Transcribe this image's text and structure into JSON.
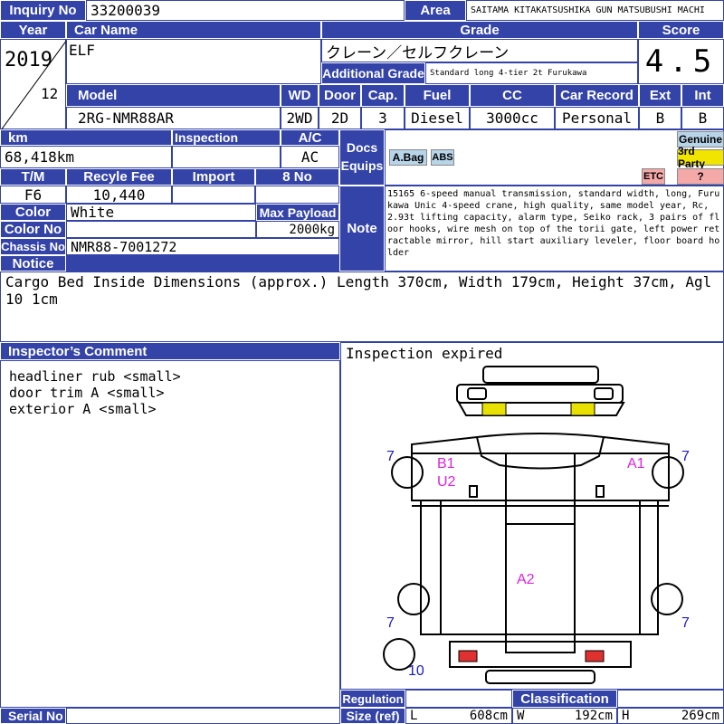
{
  "header": {
    "inquiry_label": "Inquiry No",
    "inquiry_value": "33200039",
    "area_label": "Area",
    "area_value": "SAITAMA KITAKATSUSHIKA GUN MATSUBUSHI MACHI",
    "year_label": "Year",
    "car_name_label": "Car Name",
    "grade_label": "Grade",
    "score_label": "Score",
    "year_value": "2019",
    "month_value": "12",
    "car_name_value": "ELF",
    "grade_value": "クレーン／セルフクレーン",
    "additional_grade_label": "Additional Grade",
    "additional_grade_value": "Standard long 4-tier 2t Furukawa",
    "score_value": "4.5"
  },
  "specs": {
    "model_label": "Model",
    "wd_label": "WD",
    "door_label": "Door",
    "cap_label": "Cap.",
    "fuel_label": "Fuel",
    "cc_label": "CC",
    "record_label": "Car Record",
    "ext_label": "Ext",
    "int_label": "Int",
    "model_value": "2RG-NMR88AR",
    "wd_value": "2WD",
    "door_value": "2D",
    "cap_value": "3",
    "fuel_value": "Diesel",
    "cc_value": "3000cc",
    "record_value": "Personal",
    "ext_value": "B",
    "int_value": "B"
  },
  "details": {
    "km_label": "km",
    "inspection_label": "Inspection",
    "ac_label": "A/C",
    "km_value": "68,418km",
    "inspection_value": "",
    "ac_value": "AC",
    "tm_label": "T/M",
    "recycle_label": "Recyle Fee",
    "import_label": "Import",
    "no8_label": "8 No",
    "tm_value": "F6",
    "recycle_value": "10,440",
    "color_label": "Color",
    "color_value": "White",
    "payload_label": "Max Payload",
    "payload_value": "2000kg",
    "color_no_label": "Color No",
    "chassis_label": "Chassis No",
    "chassis_value": "NMR88-7001272",
    "docs_label": "Docs Equips",
    "note_label": "Note",
    "note_value": "15165 6-speed manual transmission, standard width, long, Furukawa Unic 4-speed crane, high quality, same model year, Rc, 2.93t lifting capacity, alarm type, Seiko rack, 3 pairs of floor hooks, wire mesh on top of the torii gate, left power retractable mirror, hill start auxiliary leveler, floor board holder"
  },
  "equips": {
    "abag": "A.Bag",
    "abs": "ABS",
    "genuine": "Genuine",
    "third_party": "3rd Party",
    "etc": "ETC",
    "unknown": "?"
  },
  "notice": {
    "label": "Notice",
    "text": "Cargo Bed Inside Dimensions (approx.) Length 370cm, Width 179cm, Height 37cm, Agl 10 1cm"
  },
  "inspector": {
    "label": "Inspector’s Comment",
    "lines": [
      "headliner rub <small>",
      "door trim A <small>",
      "exterior A <small>"
    ]
  },
  "diagram": {
    "status": "Inspection expired",
    "marks": [
      "B1",
      "U2",
      "A1",
      "A2"
    ],
    "tire_labels": [
      "7",
      "7",
      "7",
      "7",
      "10"
    ]
  },
  "footer": {
    "serial_label": "Serial No",
    "regulation_label": "Regulation",
    "size_label": "Size (ref)",
    "classification_label": "Classification",
    "l_label": "L",
    "l_value": "608cm",
    "w_label": "W",
    "w_value": "192cm",
    "h_label": "H",
    "h_value": "269cm"
  },
  "colors": {
    "header_blue": "#3343a8",
    "mark_magenta": "#e020e0",
    "tire_blue": "#1a1acc",
    "yellow_part": "#e8e000",
    "red_part": "#e03030"
  }
}
